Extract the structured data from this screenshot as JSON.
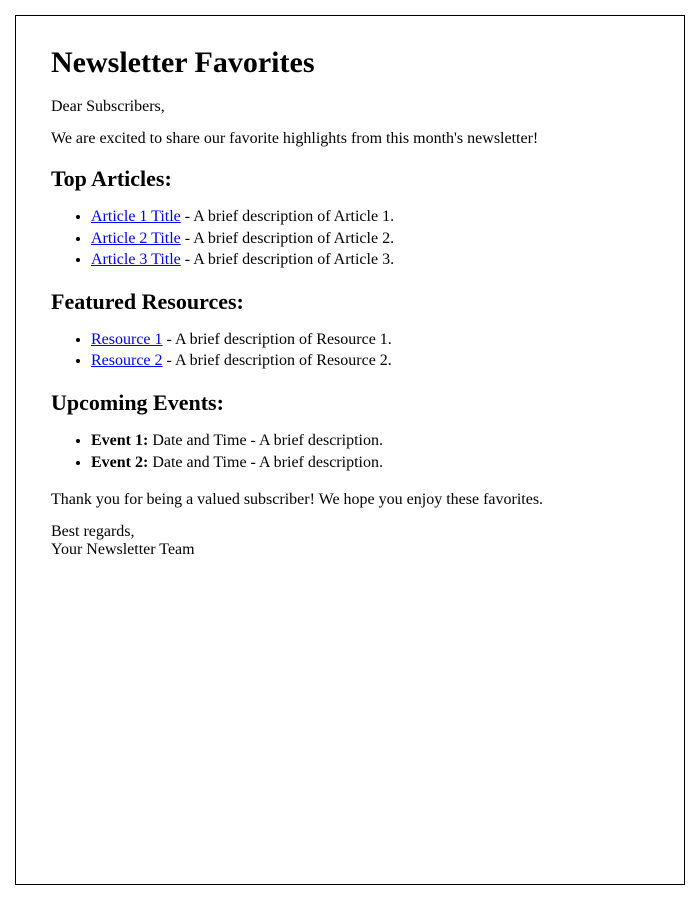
{
  "title": "Newsletter Favorites",
  "greeting": "Dear Subscribers,",
  "intro": "We are excited to share our favorite highlights from this month's newsletter!",
  "sections": {
    "articles": {
      "heading": "Top Articles:",
      "items": [
        {
          "link": "Article 1 Title",
          "desc": " - A brief description of Article 1."
        },
        {
          "link": "Article 2 Title",
          "desc": " - A brief description of Article 2."
        },
        {
          "link": "Article 3 Title",
          "desc": " - A brief description of Article 3."
        }
      ]
    },
    "resources": {
      "heading": "Featured Resources:",
      "items": [
        {
          "link": "Resource 1",
          "desc": " - A brief description of Resource 1."
        },
        {
          "link": "Resource 2",
          "desc": " - A brief description of Resource 2."
        }
      ]
    },
    "events": {
      "heading": "Upcoming Events:",
      "items": [
        {
          "label": "Event 1:",
          "desc": " Date and Time - A brief description."
        },
        {
          "label": "Event 2:",
          "desc": " Date and Time - A brief description."
        }
      ]
    }
  },
  "thanks": "Thank you for being a valued subscriber! We hope you enjoy these favorites.",
  "signoff_line1": "Best regards,",
  "signoff_line2": "Your Newsletter Team"
}
